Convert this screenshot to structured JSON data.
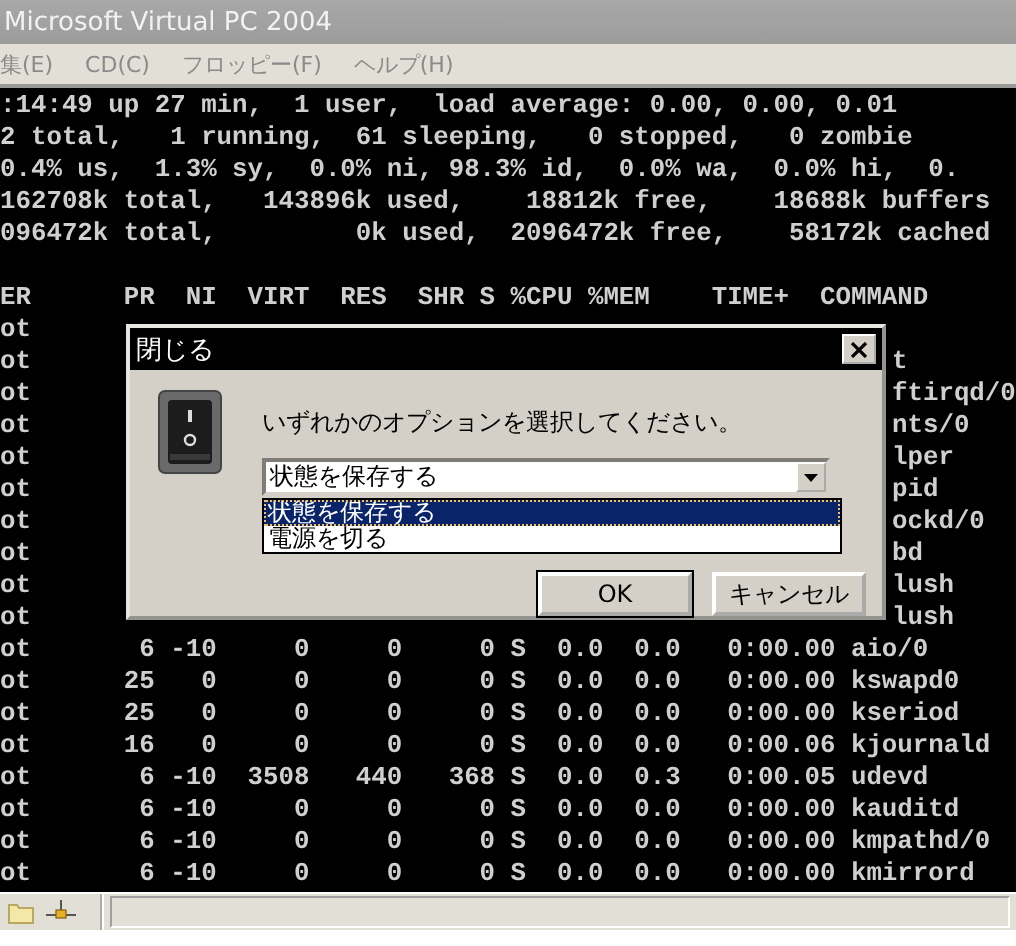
{
  "window": {
    "title": "Microsoft Virtual PC 2004"
  },
  "menu": [
    "集(E)",
    "CD(C)",
    "フロッピー(F)",
    "ヘルプ(H)"
  ],
  "terminal": {
    "summary_lines": [
      ":14:49 up 27 min,  1 user,  load average: 0.00, 0.00, 0.01",
      "2 total,   1 running,  61 sleeping,   0 stopped,   0 zombie",
      "0.4% us,  1.3% sy,  0.0% ni, 98.3% id,  0.0% wa,  0.0% hi,  0.",
      "162708k total,   143896k used,    18812k free,    18688k buffers",
      "096472k total,         0k used,  2096472k free,    58172k cached"
    ],
    "header": "ER      PR  NI  VIRT  RES  SHR S %CPU %MEM    TIME+  COMMAND",
    "rows": [
      {
        "kind": "covered",
        "left": "ot"
      },
      {
        "kind": "covered",
        "left": "ot",
        "right": "t"
      },
      {
        "kind": "covered",
        "left": "ot",
        "right": "ftirqd/0"
      },
      {
        "kind": "covered",
        "left": "ot",
        "right": "nts/0"
      },
      {
        "kind": "covered",
        "left": "ot",
        "right": "lper"
      },
      {
        "kind": "covered",
        "left": "ot",
        "right": "pid"
      },
      {
        "kind": "covered",
        "left": "ot",
        "right": "ockd/0"
      },
      {
        "kind": "covered",
        "left": "ot",
        "right": "bd"
      },
      {
        "kind": "covered",
        "left": "ot",
        "right": "lush"
      },
      {
        "kind": "covered",
        "left": "ot",
        "right": "lush"
      },
      {
        "kind": "full",
        "text": "ot       6 -10     0     0     0 S  0.0  0.0   0:00.00 aio/0"
      },
      {
        "kind": "full",
        "text": "ot      25   0     0     0     0 S  0.0  0.0   0:00.00 kswapd0"
      },
      {
        "kind": "full",
        "text": "ot      25   0     0     0     0 S  0.0  0.0   0:00.00 kseriod"
      },
      {
        "kind": "full",
        "text": "ot      16   0     0     0     0 S  0.0  0.0   0:00.06 kjournald"
      },
      {
        "kind": "full",
        "text": "ot       6 -10  3508   440   368 S  0.0  0.3   0:00.05 udevd"
      },
      {
        "kind": "full",
        "text": "ot       6 -10     0     0     0 S  0.0  0.0   0:00.00 kauditd"
      },
      {
        "kind": "full",
        "text": "ot       6 -10     0     0     0 S  0.0  0.0   0:00.00 kmpathd/0"
      },
      {
        "kind": "full",
        "text": "ot       6 -10     0     0     0 S  0.0  0.0   0:00.00 kmirrord"
      }
    ]
  },
  "dialog": {
    "title": "閉じる",
    "message": "いずれかのオプションを選択してください。",
    "combo": {
      "value": "状態を保存する"
    },
    "options": [
      {
        "label": "状態を保存する",
        "selected": true
      },
      {
        "label": "電源を切る",
        "selected": false
      }
    ],
    "buttons": [
      "OK",
      "キャンセル"
    ]
  }
}
